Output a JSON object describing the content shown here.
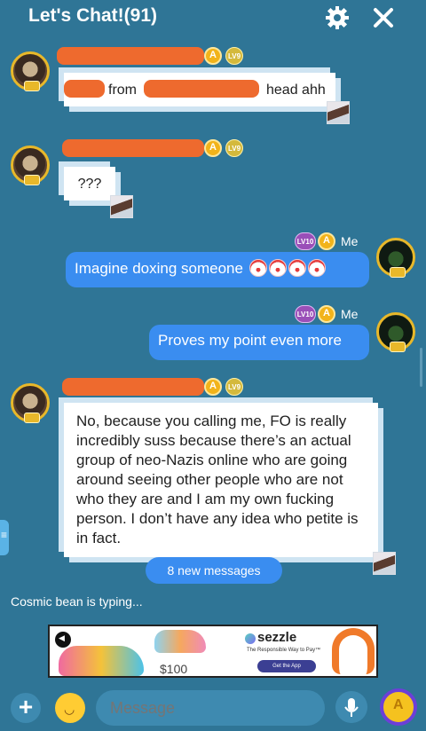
{
  "header": {
    "title": "Let's Chat!(91)",
    "settings_icon": "gear-icon",
    "close_icon": "close-icon"
  },
  "messages": [
    {
      "sender": "other",
      "level": "LV9",
      "text_visible_fragments": [
        "from",
        "head ahh"
      ]
    },
    {
      "sender": "other",
      "level": "LV9",
      "text": "???"
    },
    {
      "sender": "me",
      "level": "LV10",
      "label": "Me",
      "text": "Imagine doxing someone",
      "emoji": "clown"
    },
    {
      "sender": "me",
      "level": "LV10",
      "label": "Me",
      "text": "Proves my point even more"
    },
    {
      "sender": "other",
      "level": "LV9",
      "text": "No, because you calling me, FO is really incredibly suss because there’s an actual group of neo-Nazis online who are going around seeing other people who are not who they are and I am my own fucking person. I don’t have any idea who petite is in fact."
    }
  ],
  "new_messages_label": "8 new messages",
  "typing_indicator": "Cosmic bean is typing...",
  "ad": {
    "brand": "sezzle",
    "tagline": "The Responsible Way to Pay™",
    "cta": "Get the App",
    "price": "$100"
  },
  "composer": {
    "placeholder": "Message"
  },
  "colors": {
    "background": "#2f7596",
    "outgoing_bubble": "#3a8df0",
    "redaction": "#ee6a2e",
    "badge_gold": "#f2b31a"
  }
}
